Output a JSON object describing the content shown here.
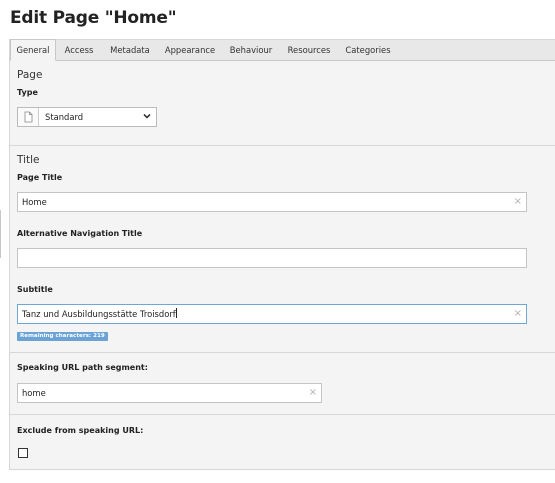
{
  "page": {
    "title": "Edit Page \"Home\""
  },
  "tabs": [
    {
      "label": "General",
      "active": true
    },
    {
      "label": "Access"
    },
    {
      "label": "Metadata"
    },
    {
      "label": "Appearance"
    },
    {
      "label": "Behaviour"
    },
    {
      "label": "Resources"
    },
    {
      "label": "Categories"
    }
  ],
  "sections": {
    "page": {
      "title": "Page",
      "type_label": "Type",
      "type_value": "Standard",
      "type_icon": "document-icon"
    },
    "title": {
      "title": "Title",
      "page_title_label": "Page Title",
      "page_title_value": "Home",
      "alt_nav_label": "Alternative Navigation Title",
      "alt_nav_value": "",
      "subtitle_label": "Subtitle",
      "subtitle_value": "Tanz und Ausbildungsstätte Troisdorf",
      "remaining_badge": "Remaining characters: 219"
    },
    "url": {
      "segment_label": "Speaking URL path segment:",
      "segment_value": "home",
      "exclude_label": "Exclude from speaking URL:",
      "exclude_checked": false
    }
  },
  "icons": {
    "clear": "×"
  },
  "colors": {
    "panel_bg": "#f4f4f4",
    "tabbar_bg": "#e8e8e8",
    "badge_bg": "#6ba3d6",
    "focus_border": "#6fa6d6"
  }
}
